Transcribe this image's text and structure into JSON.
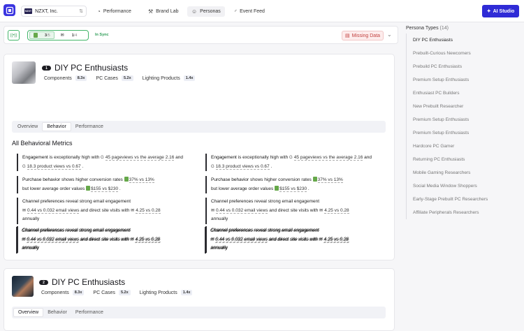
{
  "topbar": {
    "org_badge": "NZXT",
    "org_name": "NZXT, Inc.",
    "nav": [
      {
        "label": "Performance",
        "icon": "gauge-icon"
      },
      {
        "label": "Brand Lab",
        "icon": "hammer-icon"
      },
      {
        "label": "Personas",
        "icon": "user-icon",
        "active": true
      },
      {
        "label": "Event Feed",
        "icon": "rss-icon"
      }
    ],
    "ai_studio": "AI Studio"
  },
  "syncbar": {
    "shopify_count": "3",
    "shopify_total": "/5",
    "other_count": "1",
    "other_total": "/4",
    "status": "In Sync",
    "missing": "Missing Data"
  },
  "personas": [
    {
      "index": "1",
      "name": "DIY PC Enthusiasts",
      "stats": [
        {
          "label": "Components",
          "value": "8.3x"
        },
        {
          "label": "PC Cases",
          "value": "5.2x"
        },
        {
          "label": "Lighting Products",
          "value": "1.4x"
        }
      ],
      "active_tab": "Behavior"
    },
    {
      "index": "2",
      "name": "DIY PC Enthusiasts",
      "stats": [
        {
          "label": "Components",
          "value": "8.3x"
        },
        {
          "label": "PC Cases",
          "value": "5.2x"
        },
        {
          "label": "Lighting Products",
          "value": "1.4x"
        }
      ],
      "active_tab": "Overview"
    }
  ],
  "tabs": [
    "Overview",
    "Behavior",
    "Performance"
  ],
  "metrics": {
    "section_title": "All Behavioral Metrics",
    "engagement": {
      "label": "Engagement",
      "text1": " is exceptionally high with ",
      "hl1": "45 pageviews vs the average 2.16",
      "text2": "  and",
      "hl2": "18.3 product views vs 0.67",
      "text3": " ."
    },
    "purchase": {
      "label": "Purchase behavior",
      "text1": "  shows higher conversion rates ",
      "hl1": "37% vs 13%",
      "text2": "but lower average order values ",
      "hl2": "$155 vs $230",
      "text3": " ."
    },
    "channel": {
      "label": "Channel preferences",
      "text1": " reveal strong email engagement",
      "hl1": "0.44 vs 0.032 email views",
      "text2": "  and direct site visits with ",
      "hl2": "4.25 vs 0.28",
      "text3": "annually"
    }
  },
  "sidebar": {
    "title": "Persona Types",
    "count": "(14)",
    "items": [
      "DIY PC Enthusiasts",
      "Prebuilt-Curious Newcomers",
      "Prebuild PC Enthusiasts",
      "Premium Setup Enthusiasts",
      "Enthusiast PC Builders",
      "New Prebuilt Researcher",
      "Premium Setup Enthusiasts",
      "Premium Setup Enthusiasts",
      "Hardcore PC Gamer",
      "Returning PC Enthusiasts",
      "Mobile Gaming Researchers",
      "Social Media Window Shoppers",
      "Early-Stage Prebuilt PC Researchers",
      "Affiliate Peripherals Researchers"
    ]
  },
  "colors": {
    "accent": "#2f2bd6",
    "sync_green": "#43b56a",
    "missing_red": "#c2413f"
  }
}
